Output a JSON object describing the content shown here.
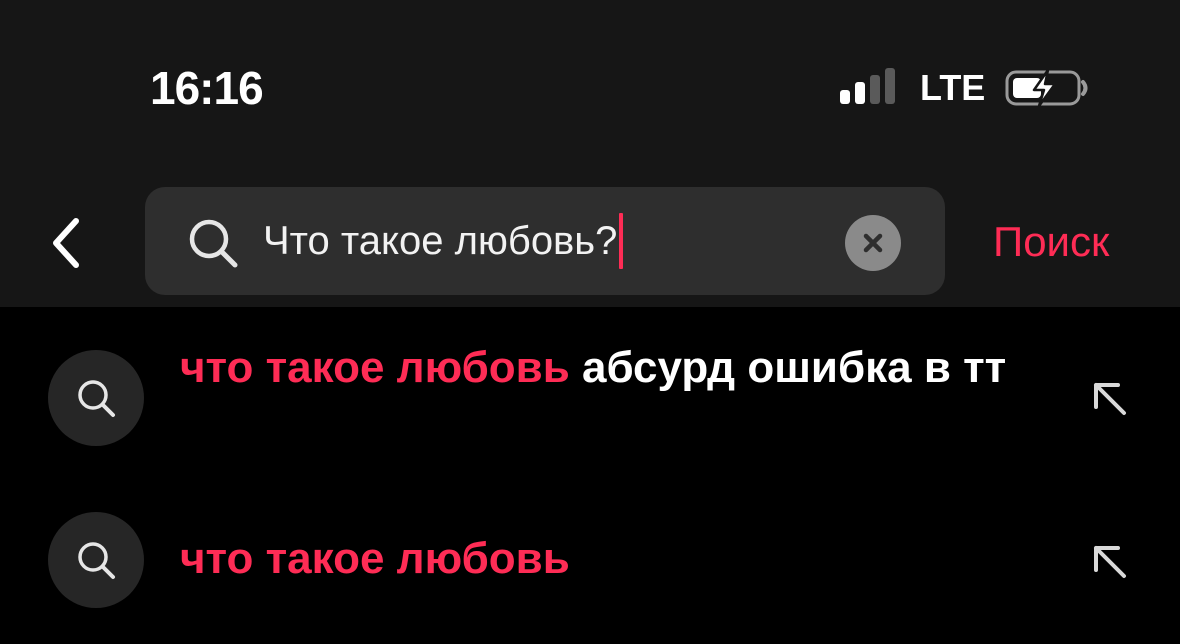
{
  "status_bar": {
    "time": "16:16",
    "network": "LTE",
    "signal_bars_active": 2,
    "signal_bars_total": 4,
    "battery_charging": true
  },
  "search": {
    "query": "Что такое любовь?",
    "submit_label": "Поиск"
  },
  "suggestions": [
    {
      "highlight": "что такое любовь",
      "rest": " абсурд ошибка в тт"
    },
    {
      "highlight": "что такое любовь",
      "rest": ""
    }
  ],
  "colors": {
    "accent": "#fe2c55",
    "background": "#000000",
    "header_background": "#161616",
    "input_background": "#2e2e2e",
    "suggestion_icon_background": "#262626"
  },
  "icons": {
    "back": "chevron-left-icon",
    "search": "search-icon",
    "clear": "clear-x-icon",
    "fill_query": "arrow-up-left-icon",
    "battery": "battery-charging-icon",
    "signal": "cellular-signal-icon"
  }
}
